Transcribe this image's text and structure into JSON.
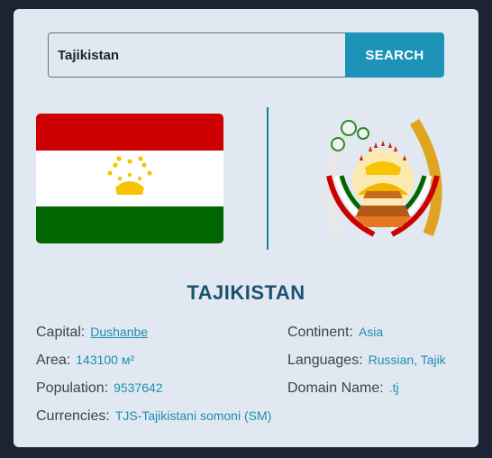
{
  "search": {
    "value": "Tajikistan",
    "button_label": "SEARCH"
  },
  "country": {
    "name": "TAJIKISTAN",
    "capital_label": "Capital:",
    "capital": "Dushanbe",
    "area_label": "Area:",
    "area": "143100 м²",
    "population_label": "Population:",
    "population": "9537642",
    "currencies_label": "Currencies:",
    "currencies": "TJS-Tajikistani somoni (SM)",
    "continent_label": "Continent:",
    "continent": "Asia",
    "languages_label": "Languages:",
    "languages": "Russian, Tajik",
    "domain_label": "Domain Name:",
    "domain": ".tj"
  },
  "colors": {
    "accent": "#1c93b7",
    "background": "#1c2333",
    "card": "#e2e8f1",
    "title": "#1a5270"
  },
  "icons": {
    "flag": "tajikistan-flag",
    "emblem": "tajikistan-emblem"
  }
}
